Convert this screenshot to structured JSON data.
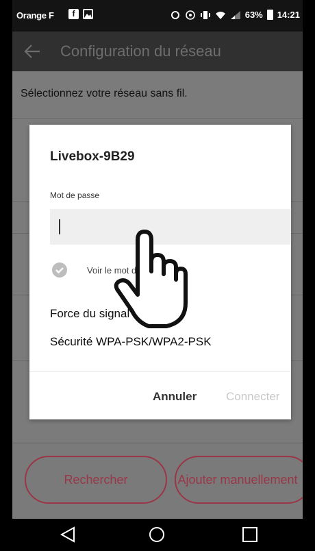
{
  "status_bar": {
    "carrier": "Orange F",
    "battery": "63%",
    "time": "14:21"
  },
  "toolbar": {
    "back_icon": "arrow-left-icon",
    "title": "Configuration du réseau"
  },
  "page": {
    "subtitle": "Sélectionnez votre réseau sans fil."
  },
  "dialog": {
    "network_name": "Livebox-9B29",
    "password_label": "Mot de passe",
    "password_value": "",
    "show_password_label": "Voir le mot de passe",
    "signal_line": "Force du signal Excellent",
    "security_line": "Sécurité WPA-PSK/WPA2-PSK",
    "cancel_label": "Annuler",
    "connect_label": "Connecter"
  },
  "buttons": {
    "search_label": "Rechercher",
    "add_manual_label": "Ajouter manuellement"
  },
  "colors": {
    "accent": "#9a3647",
    "toolbar": "#303030",
    "overlay": "#7b7b7b"
  }
}
